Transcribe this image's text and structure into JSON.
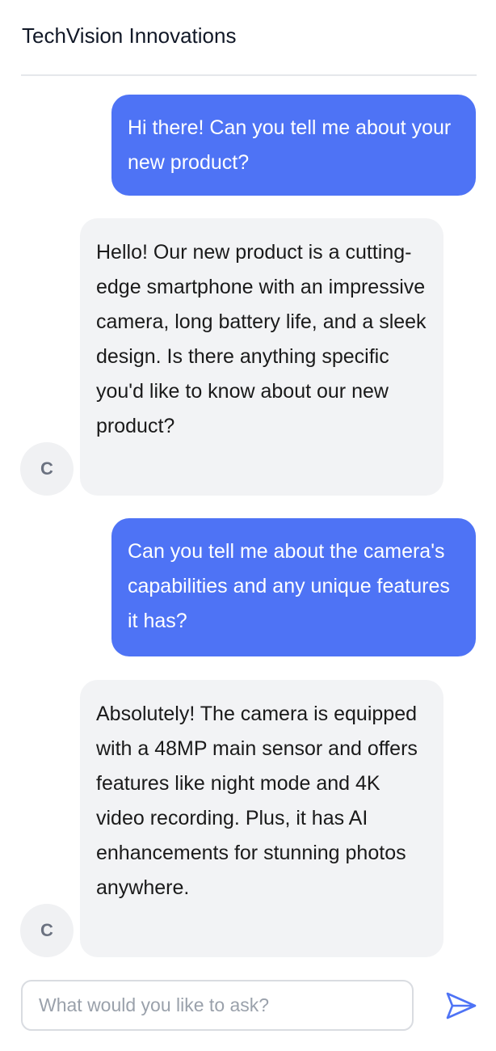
{
  "header": {
    "title": "TechVision Innovations"
  },
  "messages": [
    {
      "role": "user",
      "text": "Hi there! Can you tell me about your new product?"
    },
    {
      "role": "assistant",
      "avatar": "C",
      "text": "Hello! Our new product is a cutting-edge smartphone with an impressive camera, long battery life, and a sleek design. Is there anything specific you'd like to know about our new product?"
    },
    {
      "role": "user",
      "text": "Can you tell me about the camera's capabilities and any unique features it has?"
    },
    {
      "role": "assistant",
      "avatar": "C",
      "text": "Absolutely! The camera is equipped with a 48MP main sensor and offers features like night mode and 4K video recording. Plus, it has AI enhancements for stunning photos anywhere."
    }
  ],
  "composer": {
    "placeholder": "What would you like to ask?",
    "value": ""
  },
  "icons": {
    "send": "send-arrow-icon"
  },
  "colors": {
    "accent": "#4e73f5",
    "bot_bubble": "#f2f3f5",
    "avatar_bg": "#f0f1f3"
  }
}
